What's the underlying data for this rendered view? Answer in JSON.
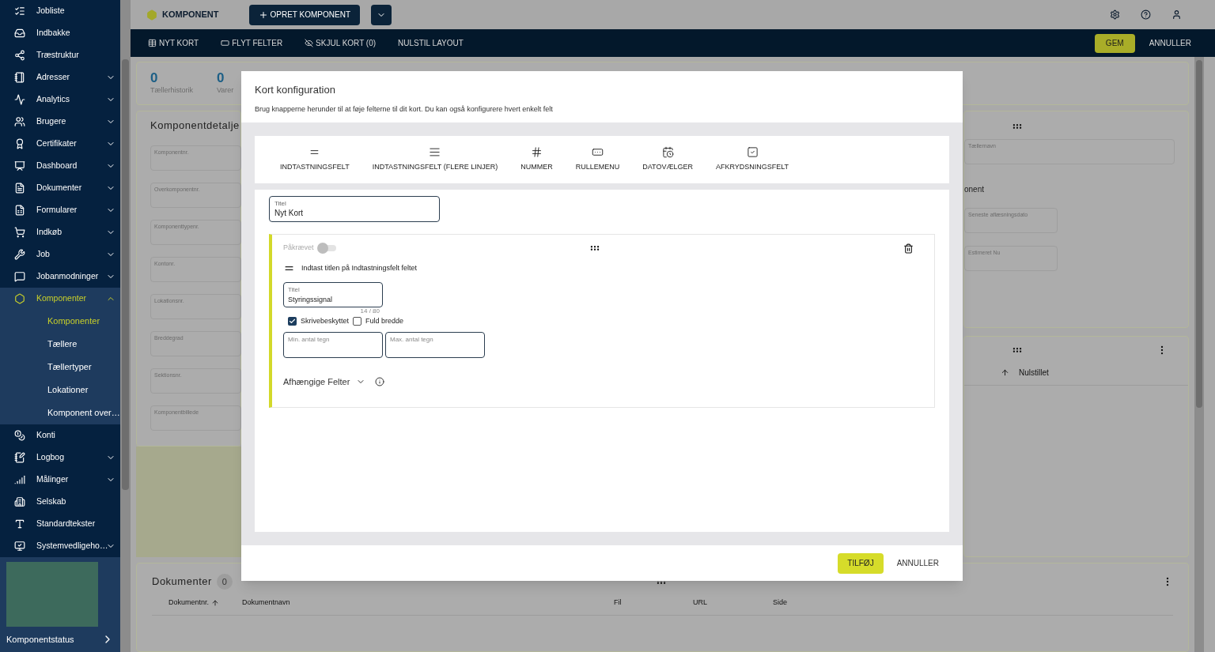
{
  "sidebar": {
    "items": [
      {
        "label": "Jobliste",
        "selected": false
      },
      {
        "label": "Indbakke",
        "selected": false
      },
      {
        "label": "Træstruktur",
        "selected": false
      },
      {
        "label": "Adresser",
        "selected": false,
        "expanded": false
      },
      {
        "label": "Analytics",
        "selected": false,
        "expanded": false
      },
      {
        "label": "Brugere",
        "selected": false,
        "expanded": false
      },
      {
        "label": "Certifikater",
        "selected": false,
        "expanded": false
      },
      {
        "label": "Dashboard",
        "selected": false,
        "expanded": false
      },
      {
        "label": "Dokumenter",
        "selected": false,
        "expanded": false
      },
      {
        "label": "Formularer",
        "selected": false,
        "expanded": false
      },
      {
        "label": "Indkøb",
        "selected": false,
        "expanded": false
      },
      {
        "label": "Job",
        "selected": false,
        "expanded": false
      },
      {
        "label": "Jobanmodninger",
        "selected": false,
        "expanded": false
      },
      {
        "label": "Komponenter",
        "selected": true,
        "expanded": true,
        "children": [
          {
            "label": "Komponenter",
            "selected": true
          },
          {
            "label": "Tællere",
            "selected": false
          },
          {
            "label": "Tællertyper",
            "selected": false
          },
          {
            "label": "Lokationer",
            "selected": false
          },
          {
            "label": "Komponent over…",
            "selected": false
          }
        ]
      },
      {
        "label": "Konti",
        "selected": false
      },
      {
        "label": "Logbog",
        "selected": false,
        "expanded": false
      },
      {
        "label": "Målinger",
        "selected": false,
        "expanded": false
      },
      {
        "label": "Selskab",
        "selected": false
      },
      {
        "label": "Standardtekster",
        "selected": false
      },
      {
        "label": "Systemvedligeho…",
        "selected": false,
        "expanded": false
      }
    ],
    "footer": {
      "label": "Komponentstatus"
    }
  },
  "header": {
    "title": "KOMPONENT",
    "create_button": "OPRET KOMPONENT"
  },
  "toolbar": {
    "items": [
      "NYT KORT",
      "FLYT FELTER",
      "SKJUL KORT (0)",
      "NULSTIL LAYOUT"
    ],
    "save": "GEM",
    "cancel": "ANNULLER"
  },
  "stats": [
    {
      "value": "0",
      "label": "Tællerhistorik"
    },
    {
      "value": "0",
      "label": "Varer"
    }
  ],
  "details_panel": {
    "title": "Komponentdetalje",
    "fields": [
      "Komponentnr.",
      "Overkomponentnr.",
      "Komponenttypenr.",
      "Kontonr.",
      "Lokationsnr.",
      "Breddegrad",
      "Sektionsnr.",
      "Komponentbillede"
    ]
  },
  "right_panel": {
    "top_field": "Tællernavn",
    "heading": "onent",
    "fields": [
      "Seneste aflæsningsdato",
      "Estimeret Nu"
    ]
  },
  "counters_panel": {
    "columns": [
      "Nulstillet"
    ]
  },
  "documents": {
    "title": "Dokumenter",
    "count": "0",
    "columns": [
      {
        "label": "Dokumentnr.",
        "sorted": true
      },
      {
        "label": "Dokumentnavn",
        "sorted": false
      },
      {
        "label": "Fil",
        "sorted": false
      },
      {
        "label": "URL",
        "sorted": false
      },
      {
        "label": "Side",
        "sorted": false
      }
    ]
  },
  "dialog": {
    "title": "Kort konfiguration",
    "description": "Brug knapperne herunder til at føje felterne til dit kort. Du kan også konfigurere hvert enkelt felt",
    "field_types": [
      "INDTASTNINGSFELT",
      "INDTASTNINGSFELT (FLERE LINJER)",
      "NUMMER",
      "RULLEMENU",
      "DATOVÆLGER",
      "AFKRYDSNINGSFELT"
    ],
    "card_title": {
      "label": "Titel",
      "value": "Nyt Kort"
    },
    "field": {
      "required": {
        "label": "Påkrævet",
        "on": false
      },
      "prompt": "Indtast titlen på Indtastningsfelt feltet",
      "title": {
        "label": "Titel",
        "value": "Styringssignal",
        "counter": "14 / 80"
      },
      "options": [
        {
          "label": "Skrivebeskyttet",
          "checked": true
        },
        {
          "label": "Fuld bredde",
          "checked": false
        }
      ],
      "limits": [
        {
          "label": "Min. antal tegn"
        },
        {
          "label": "Max. antal tegn"
        }
      ],
      "dependent": {
        "label": "Afhængige Felter",
        "expanded": false
      }
    },
    "buttons": {
      "add": "TILFØJ",
      "cancel": "ANNULLER"
    }
  }
}
